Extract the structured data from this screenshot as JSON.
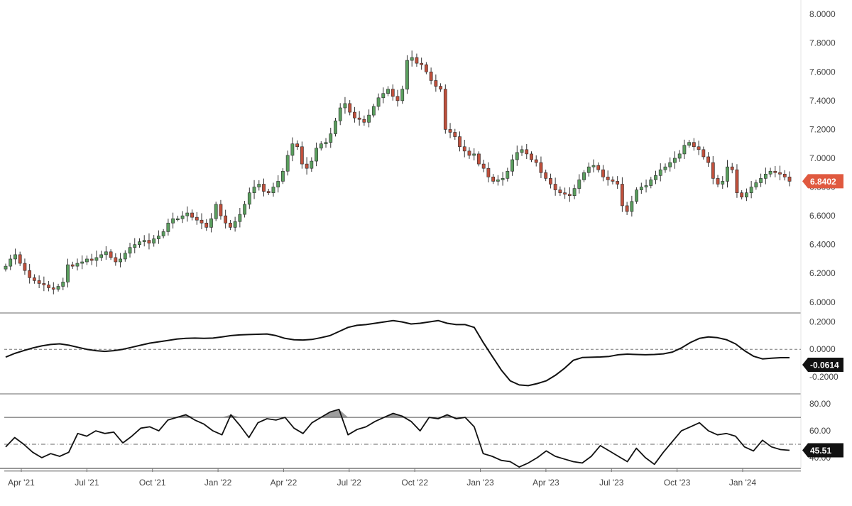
{
  "chart_data": [
    {
      "type": "candlestick",
      "panel": "price",
      "y_ticks": [
        "8.0000",
        "7.8000",
        "7.6000",
        "7.4000",
        "7.2000",
        "7.0000",
        "6.8000",
        "6.6000",
        "6.4000",
        "6.2000",
        "6.0000"
      ],
      "ylim": [
        5.93,
        8.06
      ],
      "last_value_label": "6.8402",
      "colors": {
        "up": "#5a9e5e",
        "down": "#c0503c",
        "wick": "#333333",
        "last_badge": "#e0593f"
      },
      "x_ticks": [
        "Apr '21",
        "Jul '21",
        "Oct '21",
        "Jan '22",
        "Apr '22",
        "Jul '22",
        "Oct '22",
        "Jan '23",
        "Apr '23",
        "Jul '23",
        "Oct '23",
        "Jan '24"
      ],
      "close": [
        6.25,
        6.3,
        6.33,
        6.27,
        6.22,
        6.17,
        6.15,
        6.13,
        6.12,
        6.1,
        6.09,
        6.11,
        6.14,
        6.26,
        6.25,
        6.27,
        6.28,
        6.3,
        6.29,
        6.31,
        6.33,
        6.35,
        6.31,
        6.28,
        6.3,
        6.34,
        6.38,
        6.4,
        6.42,
        6.43,
        6.41,
        6.44,
        6.46,
        6.49,
        6.55,
        6.58,
        6.58,
        6.6,
        6.62,
        6.59,
        6.57,
        6.55,
        6.52,
        6.58,
        6.68,
        6.6,
        6.55,
        6.52,
        6.56,
        6.61,
        6.68,
        6.76,
        6.8,
        6.82,
        6.77,
        6.76,
        6.8,
        6.84,
        6.91,
        7.02,
        7.1,
        7.08,
        6.96,
        6.93,
        6.98,
        7.07,
        7.1,
        7.11,
        7.17,
        7.26,
        7.35,
        7.38,
        7.32,
        7.28,
        7.27,
        7.25,
        7.3,
        7.36,
        7.42,
        7.45,
        7.48,
        7.43,
        7.4,
        7.48,
        7.68,
        7.7,
        7.66,
        7.65,
        7.6,
        7.54,
        7.5,
        7.48,
        7.2,
        7.18,
        7.15,
        7.08,
        7.05,
        7.02,
        7.03,
        6.96,
        6.93,
        6.87,
        6.84,
        6.85,
        6.86,
        6.91,
        6.99,
        7.04,
        7.06,
        7.03,
        6.99,
        6.97,
        6.9,
        6.86,
        6.82,
        6.78,
        6.76,
        6.75,
        6.74,
        6.79,
        6.85,
        6.9,
        6.94,
        6.95,
        6.92,
        6.87,
        6.85,
        6.84,
        6.82,
        6.67,
        6.63,
        6.7,
        6.78,
        6.8,
        6.81,
        6.85,
        6.88,
        6.92,
        6.94,
        6.97,
        7.0,
        7.03,
        7.09,
        7.11,
        7.08,
        7.06,
        7.01,
        6.97,
        6.86,
        6.82,
        6.84,
        6.94,
        6.92,
        6.76,
        6.73,
        6.76,
        6.8,
        6.83,
        6.86,
        6.89,
        6.91,
        6.9,
        6.89,
        6.87,
        6.84
      ]
    },
    {
      "type": "line",
      "panel": "oscillator",
      "y_ticks": [
        "0.2000",
        "0.0000",
        "-0.2000"
      ],
      "ylim": [
        -0.32,
        0.26
      ],
      "zero_line": 0,
      "last_value_label": "-0.0614",
      "values": [
        -0.057,
        -0.03,
        -0.01,
        0.01,
        0.025,
        0.035,
        0.04,
        0.03,
        0.015,
        0.0,
        -0.01,
        -0.015,
        -0.01,
        0.0,
        0.015,
        0.03,
        0.045,
        0.055,
        0.065,
        0.075,
        0.08,
        0.082,
        0.08,
        0.082,
        0.09,
        0.1,
        0.105,
        0.108,
        0.11,
        0.112,
        0.1,
        0.08,
        0.07,
        0.068,
        0.072,
        0.085,
        0.1,
        0.13,
        0.16,
        0.175,
        0.18,
        0.19,
        0.2,
        0.21,
        0.2,
        0.185,
        0.19,
        0.2,
        0.21,
        0.19,
        0.18,
        0.18,
        0.16,
        0.05,
        -0.05,
        -0.15,
        -0.23,
        -0.26,
        -0.265,
        -0.25,
        -0.23,
        -0.19,
        -0.14,
        -0.08,
        -0.06,
        -0.058,
        -0.056,
        -0.052,
        -0.04,
        -0.035,
        -0.038,
        -0.04,
        -0.038,
        -0.033,
        -0.02,
        0.01,
        0.05,
        0.08,
        0.09,
        0.085,
        0.07,
        0.04,
        -0.01,
        -0.05,
        -0.07,
        -0.065,
        -0.061,
        -0.061
      ]
    },
    {
      "type": "line",
      "panel": "rsi",
      "y_ticks": [
        "80.00",
        "60.00",
        "40.00"
      ],
      "ylim": [
        32,
        87
      ],
      "bands": [
        70,
        50,
        30
      ],
      "last_value_label": "45.51",
      "colors": {
        "line": "#111111",
        "overbought_fill": "#9e9e9e",
        "badge": "#111111"
      },
      "values": [
        48,
        55,
        50,
        44,
        40,
        43,
        41,
        44,
        58,
        56,
        60,
        58,
        59,
        51,
        56,
        62,
        63,
        60,
        68,
        70,
        72,
        68,
        65,
        60,
        57,
        72,
        64,
        55,
        66,
        69,
        68,
        70,
        62,
        58,
        66,
        70,
        74,
        76,
        57,
        61,
        63,
        67,
        70,
        73,
        71,
        67,
        60,
        70,
        69,
        72,
        69,
        70,
        63,
        43,
        41,
        38,
        37,
        33,
        36,
        40,
        45,
        41,
        39,
        37,
        36,
        41,
        49,
        45,
        41,
        37,
        47,
        40,
        35,
        44,
        52,
        60,
        63,
        66,
        60,
        57,
        58,
        56,
        48,
        45,
        53,
        48,
        46,
        45.51
      ]
    }
  ]
}
